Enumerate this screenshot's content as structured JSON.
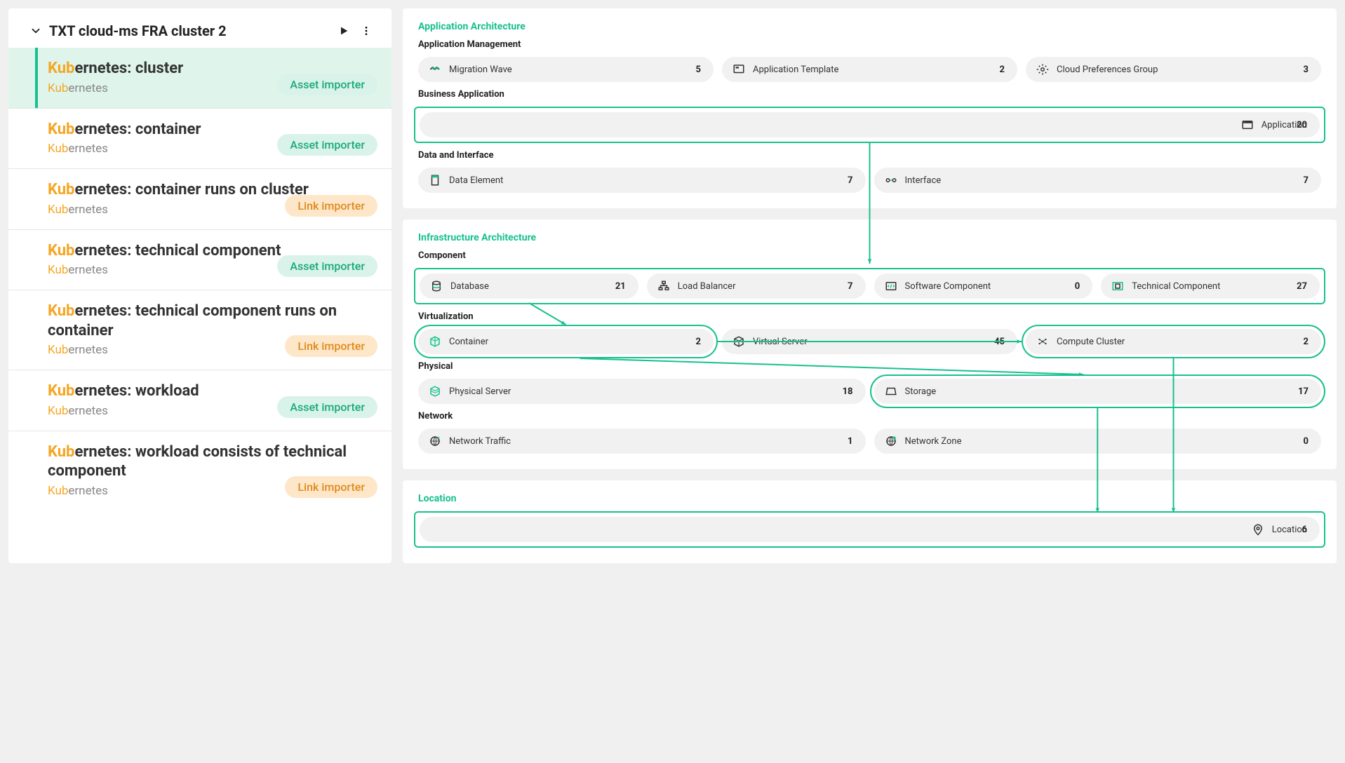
{
  "left": {
    "header": "TXT cloud-ms FRA cluster 2",
    "items": [
      {
        "prefix": "Kub",
        "title_rest": "ernetes: cluster",
        "sub_prefix": "Kub",
        "sub_rest": "ernetes",
        "badge": "Asset importer",
        "badge_kind": "asset",
        "active": true
      },
      {
        "prefix": "Kub",
        "title_rest": "ernetes: container",
        "sub_prefix": "Kub",
        "sub_rest": "ernetes",
        "badge": "Asset importer",
        "badge_kind": "asset",
        "active": false
      },
      {
        "prefix": "Kub",
        "title_rest": "ernetes: container runs on cluster",
        "sub_prefix": "Kub",
        "sub_rest": "ernetes",
        "badge": "Link importer",
        "badge_kind": "link",
        "active": false
      },
      {
        "prefix": "Kub",
        "title_rest": "ernetes: technical component",
        "sub_prefix": "Kub",
        "sub_rest": "ernetes",
        "badge": "Asset importer",
        "badge_kind": "asset",
        "active": false
      },
      {
        "prefix": "Kub",
        "title_rest": "ernetes: technical component runs on container",
        "sub_prefix": "Kub",
        "sub_rest": "ernetes",
        "badge": "Link importer",
        "badge_kind": "link",
        "active": false
      },
      {
        "prefix": "Kub",
        "title_rest": "ernetes: workload",
        "sub_prefix": "Kub",
        "sub_rest": "ernetes",
        "badge": "Asset importer",
        "badge_kind": "asset",
        "active": false
      },
      {
        "prefix": "Kub",
        "title_rest": "ernetes: workload consists of technical component",
        "sub_prefix": "Kub",
        "sub_rest": "ernetes",
        "badge": "Link importer",
        "badge_kind": "link",
        "active": false
      }
    ]
  },
  "right": {
    "sections": [
      {
        "title": "Application Architecture",
        "groups": [
          {
            "title": "Application Management",
            "boxed": false,
            "pills": [
              {
                "id": "migration-wave",
                "icon": "wave",
                "label": "Migration Wave",
                "count": 5,
                "boxed": false
              },
              {
                "id": "application-template",
                "icon": "template",
                "label": "Application Template",
                "count": 2,
                "boxed": false
              },
              {
                "id": "cloud-preferences-group",
                "icon": "gear",
                "label": "Cloud Preferences Group",
                "count": 3,
                "boxed": false
              }
            ]
          },
          {
            "title": "Business Application",
            "boxed": true,
            "pills": [
              {
                "id": "application",
                "icon": "app",
                "label": "Application",
                "count": 20,
                "boxed": false,
                "full": true
              }
            ]
          },
          {
            "title": "Data and Interface",
            "boxed": false,
            "pills": [
              {
                "id": "data-element",
                "icon": "data",
                "label": "Data Element",
                "count": 7,
                "boxed": false
              },
              {
                "id": "interface",
                "icon": "interface",
                "label": "Interface",
                "count": 7,
                "boxed": false
              }
            ]
          }
        ]
      },
      {
        "title": "Infrastructure Architecture",
        "groups": [
          {
            "title": "Component",
            "boxed": true,
            "pills": [
              {
                "id": "database",
                "icon": "database",
                "label": "Database",
                "count": 21,
                "boxed": false
              },
              {
                "id": "load-balancer",
                "icon": "loadbalancer",
                "label": "Load Balancer",
                "count": 7,
                "boxed": false
              },
              {
                "id": "software-component",
                "icon": "software",
                "label": "Software Component",
                "count": 0,
                "boxed": false
              },
              {
                "id": "technical-component",
                "icon": "techcomp",
                "label": "Technical Component",
                "count": 27,
                "boxed": false
              }
            ]
          },
          {
            "title": "Virtualization",
            "boxed": false,
            "pills": [
              {
                "id": "container",
                "icon": "container",
                "label": "Container",
                "count": 2,
                "boxed": true
              },
              {
                "id": "virtual-server",
                "icon": "vserver",
                "label": "Virtual Server",
                "count": 45,
                "boxed": false
              },
              {
                "id": "compute-cluster",
                "icon": "cluster",
                "label": "Compute Cluster",
                "count": 2,
                "boxed": true
              }
            ]
          },
          {
            "title": "Physical",
            "boxed": false,
            "pills": [
              {
                "id": "physical-server",
                "icon": "pserver",
                "label": "Physical Server",
                "count": 18,
                "boxed": false
              },
              {
                "id": "storage",
                "icon": "storage",
                "label": "Storage",
                "count": 17,
                "boxed": true
              }
            ]
          },
          {
            "title": "Network",
            "boxed": false,
            "pills": [
              {
                "id": "network-traffic",
                "icon": "nettraffic",
                "label": "Network Traffic",
                "count": 1,
                "boxed": false
              },
              {
                "id": "network-zone",
                "icon": "netzone",
                "label": "Network Zone",
                "count": 0,
                "boxed": false
              }
            ]
          }
        ]
      },
      {
        "title": "Location",
        "groups": [
          {
            "title": "",
            "boxed": true,
            "pills": [
              {
                "id": "location",
                "icon": "location",
                "label": "Location",
                "count": 6,
                "boxed": false,
                "full": true
              }
            ]
          }
        ]
      }
    ]
  }
}
